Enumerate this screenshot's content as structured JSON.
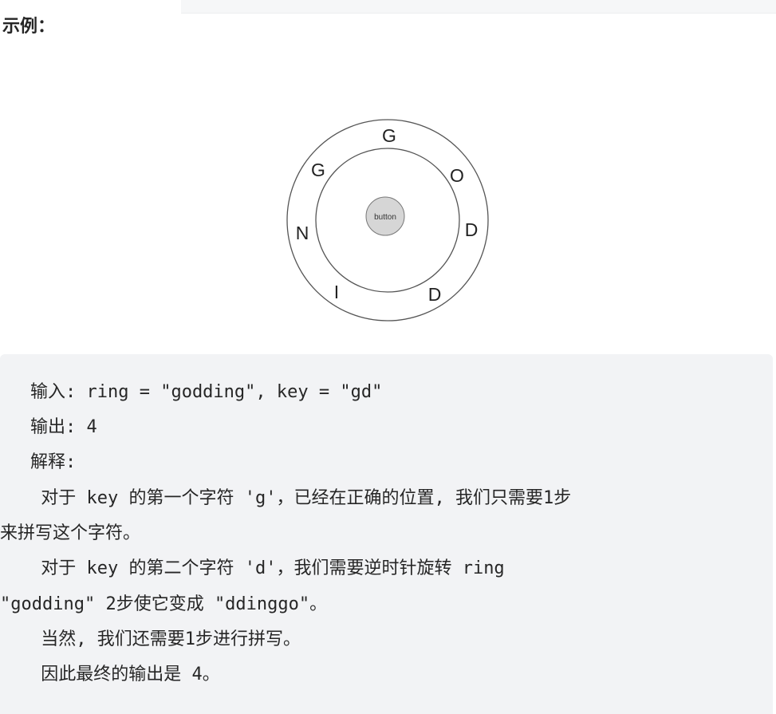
{
  "heading": "示例：",
  "figure": {
    "letters": [
      "G",
      "O",
      "D",
      "D",
      "I",
      "N",
      "G"
    ],
    "button_label": "button"
  },
  "example": {
    "input_line": "输入: ring = \"godding\", key = \"gd\"",
    "output_line": "输出: 4",
    "explanation_title": "解释:",
    "explanation_1a": " 对于 key 的第一个字符 'g'，已经在正确的位置, 我们只需要1步",
    "explanation_1b": "来拼写这个字符。",
    "explanation_2a": " 对于 key 的第二个字符 'd'，我们需要逆时针旋转 ring",
    "explanation_2b": "\"godding\" 2步使它变成 \"ddinggo\"。",
    "explanation_3": " 当然, 我们还需要1步进行拼写。",
    "explanation_4": " 因此最终的输出是 4。"
  }
}
